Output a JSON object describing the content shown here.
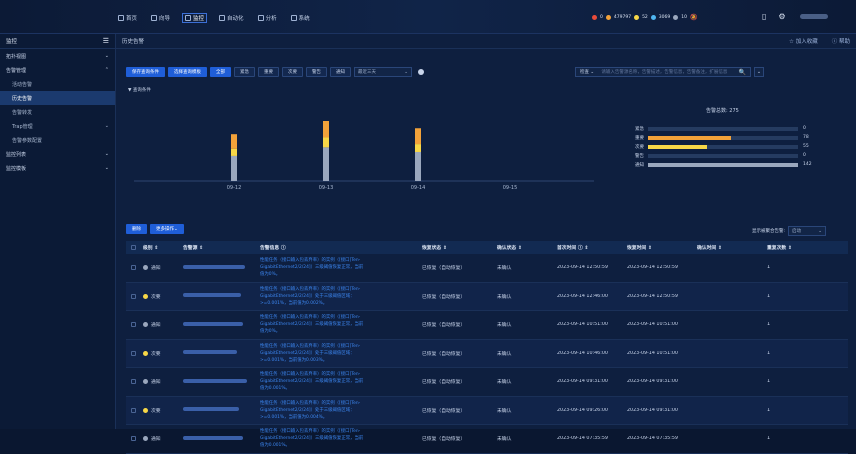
{
  "nav": {
    "items": [
      {
        "label": "首页",
        "icon": "home-icon"
      },
      {
        "label": "向导",
        "icon": "guide-icon"
      },
      {
        "label": "监控",
        "icon": "monitor-icon",
        "active": true
      },
      {
        "label": "自动化",
        "icon": "automation-icon"
      },
      {
        "label": "分析",
        "icon": "analysis-icon"
      },
      {
        "label": "系统",
        "icon": "system-icon"
      }
    ]
  },
  "status": {
    "items": [
      {
        "color": "#e84b3a",
        "value": "0"
      },
      {
        "color": "#f2a23a",
        "value": "479797"
      },
      {
        "color": "#f7d747",
        "value": "52"
      },
      {
        "color": "#4fb6f0",
        "value": "3069"
      },
      {
        "color": "#9aa7bd",
        "value": "10"
      }
    ]
  },
  "sidebar": {
    "title": "监控",
    "items": [
      {
        "label": "拓扑视图",
        "level": 0,
        "arrow": "⌄"
      },
      {
        "label": "告警管理",
        "level": 0,
        "arrow": "⌃"
      },
      {
        "label": "活动告警",
        "level": 1
      },
      {
        "label": "历史告警",
        "level": 1,
        "active": true
      },
      {
        "label": "告警转发",
        "level": 1
      },
      {
        "label": "Trap管理",
        "level": 1,
        "arrow": "⌄"
      },
      {
        "label": "告警参数配置",
        "level": 1
      },
      {
        "label": "监控列表",
        "level": 0,
        "arrow": "⌄"
      },
      {
        "label": "监控模板",
        "level": 0,
        "arrow": "⌄"
      }
    ]
  },
  "breadcrumb": {
    "title": "历史告警",
    "add_favorite": "加入收藏",
    "help": "帮助"
  },
  "toolbar": {
    "save_query": "保存查询条件",
    "query_template": "选择查询模板",
    "sev_all": "全部",
    "sev_critical": "紧急",
    "sev_major": "重要",
    "sev_minor": "次要",
    "sev_warning": "警告",
    "sev_notice": "通知",
    "time_range": "最近三天"
  },
  "search": {
    "scope": "检查",
    "placeholder": "请输入告警源名称，告警描述，告警信息，告警备注，扩展信息"
  },
  "query_conditions": "查询条件",
  "chart_data": {
    "type": "bar",
    "stacked": true,
    "categories": [
      "09-12",
      "09-13",
      "09-14",
      "09-15"
    ],
    "series": [
      {
        "name": "紧急",
        "color": "#e84b3a",
        "values": [
          0,
          0,
          0,
          0
        ]
      },
      {
        "name": "重要",
        "color": "#f2a23a",
        "values": [
          22,
          25,
          24,
          0
        ]
      },
      {
        "name": "次要",
        "color": "#f7d747",
        "values": [
          11,
          15,
          12,
          0
        ]
      },
      {
        "name": "警告",
        "color": "#4fb6f0",
        "values": [
          0,
          0,
          0,
          0
        ]
      },
      {
        "name": "通知",
        "color": "#9aa7bd",
        "values": [
          38,
          51,
          44,
          0
        ]
      }
    ],
    "total_label": "告警总数: 275"
  },
  "legend": {
    "rows": [
      {
        "label": "紧急",
        "value": "0",
        "color": "#e84b3a",
        "frac": 0
      },
      {
        "label": "重要",
        "value": "78",
        "color": "#f2a23a",
        "frac": 0.55
      },
      {
        "label": "次要",
        "value": "55",
        "color": "#f7d747",
        "frac": 0.39
      },
      {
        "label": "警告",
        "value": "0",
        "color": "#4fb6f0",
        "frac": 0
      },
      {
        "label": "通知",
        "value": "142",
        "color": "#9aa7bd",
        "frac": 1.0
      }
    ]
  },
  "actions": {
    "delete": "删除",
    "more": "更多操作",
    "aggregate_label": "显示被聚合告警:",
    "aggregate_value": "启动"
  },
  "table": {
    "headers": [
      "级别",
      "告警源",
      "告警信息",
      "恢复状态",
      "确认状态",
      "首次时间",
      "恢复时间",
      "确认时间",
      "重复次数"
    ],
    "rows": [
      {
        "sev": "通知",
        "sevcolor": "#9aa7bd",
        "info1": "性能任务（接口输入包丢弃率）的实例（[接口]Ten-",
        "info2": "GigabitEthernet2/2/24]）三级阈值恢复正常，当前",
        "info3": "值为0%。",
        "rec": "已恢复（自动恢复）",
        "ack": "未确认",
        "first": "2023-09-14 12:50:59",
        "recov": "2023-09-14 12:50:59",
        "count": "1"
      },
      {
        "sev": "次要",
        "sevcolor": "#f7d747",
        "info1": "性能任务（接口输入包丢弃率）的实例（[接口]Ten-",
        "info2": "GigabitEthernet2/2/24]）处于三级阈值区域：",
        "info3": ">=0.001%，当前值为0.002%。",
        "rec": "已恢复（自动恢复）",
        "ack": "未确认",
        "first": "2023-09-14 12:46:00",
        "recov": "2023-09-14 12:50:59",
        "count": "1"
      },
      {
        "sev": "通知",
        "sevcolor": "#9aa7bd",
        "info1": "性能任务（接口输入包丢弃率）的实例（[接口]Ten-",
        "info2": "GigabitEthernet2/2/24]）三级阈值恢复正常，当前",
        "info3": "值为0%。",
        "rec": "已恢复（自动恢复）",
        "ack": "未确认",
        "first": "2023-09-14 10:51:00",
        "recov": "2023-09-14 10:51:00",
        "count": "1"
      },
      {
        "sev": "次要",
        "sevcolor": "#f7d747",
        "info1": "性能任务（接口输入包丢弃率）的实例（[接口]Ten-",
        "info2": "GigabitEthernet2/2/24]）处于三级阈值区域：",
        "info3": ">=0.001%，当前值为0.003%。",
        "rec": "已恢复（自动恢复）",
        "ack": "未确认",
        "first": "2023-09-14 10:46:00",
        "recov": "2023-09-14 10:51:00",
        "count": "1"
      },
      {
        "sev": "通知",
        "sevcolor": "#9aa7bd",
        "info1": "性能任务（接口输入包丢弃率）的实例（[接口]Ten-",
        "info2": "GigabitEthernet2/2/24]）三级阈值恢复正常，当前",
        "info3": "值为0.001%。",
        "rec": "已恢复（自动恢复）",
        "ack": "未确认",
        "first": "2023-09-14 09:31:00",
        "recov": "2023-09-14 09:31:00",
        "count": "1"
      },
      {
        "sev": "次要",
        "sevcolor": "#f7d747",
        "info1": "性能任务（接口输入包丢弃率）的实例（[接口]Ten-",
        "info2": "GigabitEthernet2/2/24]）处于三级阈值区域：",
        "info3": ">=0.001%，当前值为0.004%。",
        "rec": "已恢复（自动恢复）",
        "ack": "未确认",
        "first": "2023-09-14 09:26:00",
        "recov": "2023-09-14 09:31:00",
        "count": "1"
      },
      {
        "sev": "通知",
        "sevcolor": "#9aa7bd",
        "info1": "性能任务（接口输入包丢弃率）的实例（[接口]Ten-",
        "info2": "GigabitEthernet2/2/24]）三级阈值恢复正常，当前",
        "info3": "值为0.001%。",
        "rec": "已恢复（自动恢复）",
        "ack": "未确认",
        "first": "2023-09-14 07:35:59",
        "recov": "2023-09-14 07:35:59",
        "count": "1"
      }
    ]
  }
}
